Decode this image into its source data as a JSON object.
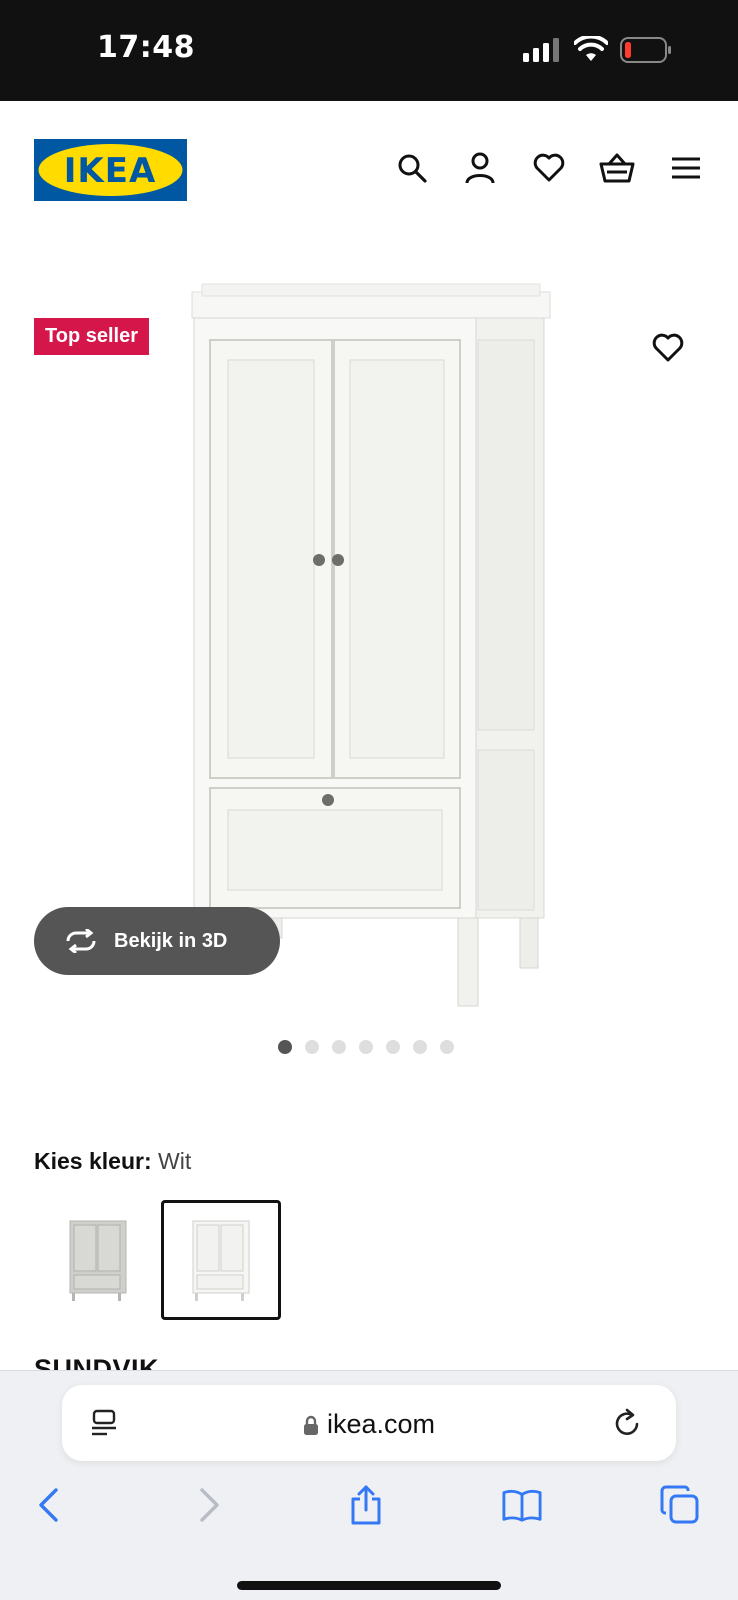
{
  "status_bar": {
    "time": "17:48"
  },
  "header": {
    "logo_text": "IKEA",
    "icons": [
      "search-icon",
      "account-icon",
      "heart-icon",
      "cart-icon",
      "menu-icon"
    ]
  },
  "product": {
    "badge": "Top seller",
    "view_3d_label": "Bekijk in 3D",
    "image_count": 7,
    "active_image": 1,
    "name": "SUNDVIK"
  },
  "color_choice": {
    "label": "Kies kleur:",
    "value": "Wit",
    "options": [
      "grey-variant",
      "white-variant"
    ],
    "selected_index": 1
  },
  "browser": {
    "url": "ikea.com"
  },
  "colors": {
    "status_bar_bg": "#111111",
    "ikea_blue": "#0058a3",
    "ikea_yellow": "#ffdb00",
    "badge_bg": "#d4164b",
    "view3d_bg": "#555555",
    "safari_blue": "#3478f6"
  }
}
